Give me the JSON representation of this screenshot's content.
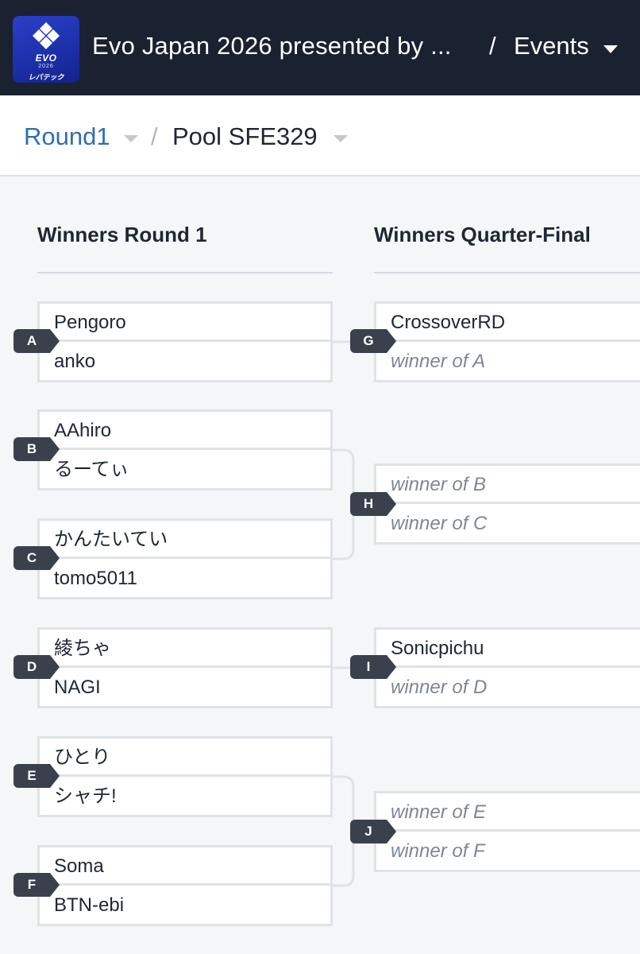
{
  "topbar": {
    "logo": {
      "name": "evo-japan-logo",
      "text": "EVO",
      "sub": "2026",
      "sponsor": "レバテック"
    },
    "title": "Evo Japan 2026 presented by ...",
    "separator": "/",
    "events_label": "Events"
  },
  "breadcrumb": {
    "round": "Round1",
    "separator": "/",
    "pool": "Pool SFE329"
  },
  "rounds": [
    {
      "title": "Winners Round 1"
    },
    {
      "title": "Winners Quarter-Final"
    }
  ],
  "matches": {
    "A": {
      "id": "A",
      "top": "Pengoro",
      "bottom": "anko"
    },
    "B": {
      "id": "B",
      "top": "AAhiro",
      "bottom": "るーてぃ"
    },
    "C": {
      "id": "C",
      "top": "かんたいてい",
      "bottom": "tomo5011"
    },
    "D": {
      "id": "D",
      "top": "綾ちゃ",
      "bottom": "NAGI"
    },
    "E": {
      "id": "E",
      "top": "ひとり",
      "bottom": "シャチ!"
    },
    "F": {
      "id": "F",
      "top": "Soma",
      "bottom": "BTN-ebi"
    },
    "G": {
      "id": "G",
      "top": "CrossoverRD",
      "bottom": "winner of A"
    },
    "H": {
      "id": "H",
      "top": "winner of B",
      "bottom": "winner of C"
    },
    "I": {
      "id": "I",
      "top": "Sonicpichu",
      "bottom": "winner of D"
    },
    "J": {
      "id": "J",
      "top": "winner of E",
      "bottom": "winner of F"
    }
  },
  "colors": {
    "topbar_bg": "#1a2130",
    "link_blue": "#2f6eb0",
    "badge_bg": "#3a414d",
    "placeholder_text": "#7f8693"
  }
}
